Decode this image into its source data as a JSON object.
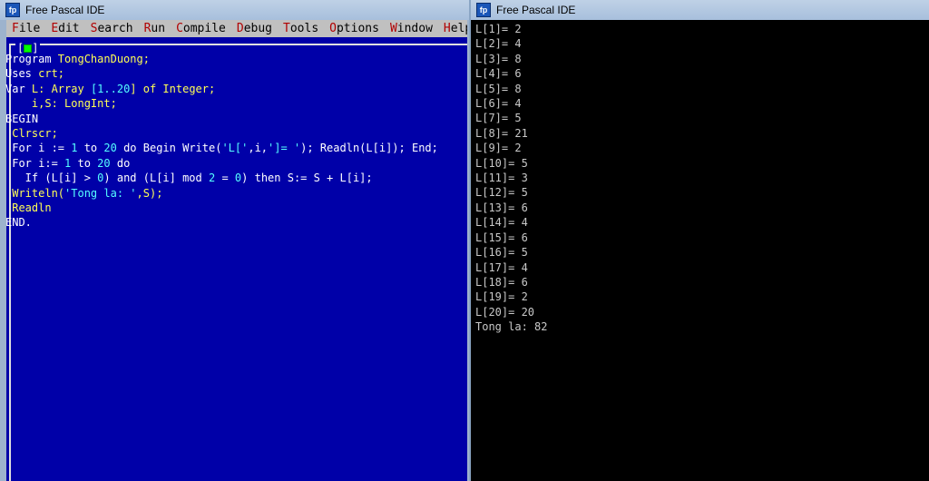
{
  "ide": {
    "title": "Free Pascal IDE",
    "menu": [
      {
        "hot": "F",
        "rest": "ile"
      },
      {
        "hot": "E",
        "rest": "dit"
      },
      {
        "hot": "S",
        "rest": "earch"
      },
      {
        "hot": "R",
        "rest": "un"
      },
      {
        "hot": "C",
        "rest": "ompile"
      },
      {
        "hot": "D",
        "rest": "ebug"
      },
      {
        "hot": "T",
        "rest": "ools"
      },
      {
        "hot": "O",
        "rest": "ptions"
      },
      {
        "hot": "W",
        "rest": "indow"
      },
      {
        "hot": "H",
        "rest": "elp"
      }
    ],
    "editor_frame_label": "[ ]",
    "code_lines": [
      [
        {
          "t": "Program "
        },
        {
          "t": "TongChanDuong;",
          "c": "y"
        }
      ],
      [
        {
          "t": "Uses "
        },
        {
          "t": "crt;",
          "c": "y"
        }
      ],
      [
        {
          "t": "Var "
        },
        {
          "t": "L: Array ",
          "c": "y"
        },
        {
          "t": "[1..",
          "c": "c"
        },
        {
          "t": "20",
          "c": "c"
        },
        {
          "t": "] of Integer;",
          "c": "y"
        }
      ],
      [
        {
          "t": "    "
        },
        {
          "t": "i,S: LongInt;",
          "c": "y"
        }
      ],
      [
        {
          "t": "BEGIN"
        }
      ],
      [
        {
          "t": " "
        },
        {
          "t": "Clrscr;",
          "c": "y"
        }
      ],
      [
        {
          "t": " For i := "
        },
        {
          "t": "1",
          "c": "c"
        },
        {
          "t": " to "
        },
        {
          "t": "20",
          "c": "c"
        },
        {
          "t": " do Begin Write("
        },
        {
          "t": "'L['",
          "c": "c"
        },
        {
          "t": ",i,"
        },
        {
          "t": "']= '",
          "c": "c"
        },
        {
          "t": "); Readln(L[i]); End;"
        }
      ],
      [
        {
          "t": " For i:= "
        },
        {
          "t": "1",
          "c": "c"
        },
        {
          "t": " to "
        },
        {
          "t": "20",
          "c": "c"
        },
        {
          "t": " do"
        }
      ],
      [
        {
          "t": "   If (L[i] > "
        },
        {
          "t": "0",
          "c": "c"
        },
        {
          "t": ") and (L[i] mod "
        },
        {
          "t": "2",
          "c": "c"
        },
        {
          "t": " = "
        },
        {
          "t": "0",
          "c": "c"
        },
        {
          "t": ") then S:= S + L[i];"
        }
      ],
      [
        {
          "t": " "
        },
        {
          "t": "Writeln(",
          "c": "y"
        },
        {
          "t": "'Tong la: '",
          "c": "c"
        },
        {
          "t": ",S);",
          "c": "y"
        }
      ],
      [
        {
          "t": " "
        },
        {
          "t": "Readln",
          "c": "y"
        }
      ],
      [
        {
          "t": "END."
        }
      ]
    ]
  },
  "console": {
    "title": "Free Pascal IDE",
    "output_lines": [
      "L[1]= 2",
      "L[2]= 4",
      "L[3]= 8",
      "L[4]= 6",
      "L[5]= 8",
      "L[6]= 4",
      "L[7]= 5",
      "L[8]= 21",
      "L[9]= 2",
      "L[10]= 5",
      "L[11]= 3",
      "L[12]= 5",
      "L[13]= 6",
      "L[14]= 4",
      "L[15]= 6",
      "L[16]= 5",
      "L[17]= 4",
      "L[18]= 6",
      "L[19]= 2",
      "L[20]= 20",
      "Tong la: 82"
    ]
  }
}
